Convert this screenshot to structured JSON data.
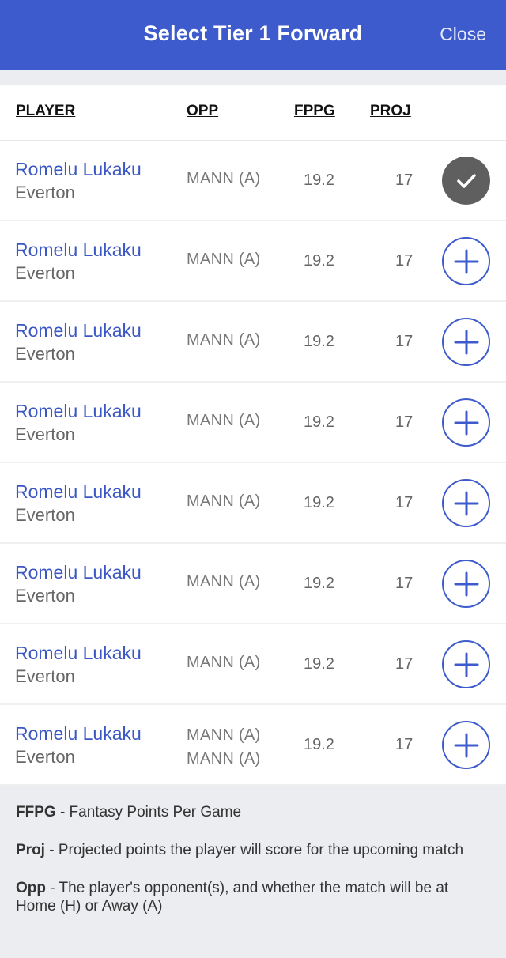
{
  "header": {
    "title": "Select Tier 1 Forward",
    "close_label": "Close"
  },
  "columns": {
    "player": "PLAYER",
    "opp": "OPP",
    "fppg": "FPPG",
    "proj": "PROJ"
  },
  "rows": [
    {
      "name": "Romelu Lukaku",
      "team": "Everton",
      "opp": [
        "MANN (A)"
      ],
      "fppg": "19.2",
      "proj": "17",
      "selected": true
    },
    {
      "name": "Romelu Lukaku",
      "team": "Everton",
      "opp": [
        "MANN (A)"
      ],
      "fppg": "19.2",
      "proj": "17",
      "selected": false
    },
    {
      "name": "Romelu Lukaku",
      "team": "Everton",
      "opp": [
        "MANN (A)"
      ],
      "fppg": "19.2",
      "proj": "17",
      "selected": false
    },
    {
      "name": "Romelu Lukaku",
      "team": "Everton",
      "opp": [
        "MANN (A)"
      ],
      "fppg": "19.2",
      "proj": "17",
      "selected": false
    },
    {
      "name": "Romelu Lukaku",
      "team": "Everton",
      "opp": [
        "MANN (A)"
      ],
      "fppg": "19.2",
      "proj": "17",
      "selected": false
    },
    {
      "name": "Romelu Lukaku",
      "team": "Everton",
      "opp": [
        "MANN (A)"
      ],
      "fppg": "19.2",
      "proj": "17",
      "selected": false
    },
    {
      "name": "Romelu Lukaku",
      "team": "Everton",
      "opp": [
        "MANN (A)"
      ],
      "fppg": "19.2",
      "proj": "17",
      "selected": false
    },
    {
      "name": "Romelu Lukaku",
      "team": "Everton",
      "opp": [
        "MANN (A)",
        "MANN (A)"
      ],
      "fppg": "19.2",
      "proj": "17",
      "selected": false
    }
  ],
  "icons": {
    "selected": "checkmark-icon",
    "add": "plus-icon"
  },
  "colors": {
    "accent": "#3d5bcc",
    "selected_bg": "#5f5f5f"
  },
  "legend": [
    {
      "term": "FFPG",
      "text": " - Fantasy Points Per Game"
    },
    {
      "term": "Proj",
      "text": " - Projected points the player will score for the upcoming match"
    },
    {
      "term": "Opp",
      "text": " - The player's opponent(s), and whether the match will be at Home (H) or Away (A)"
    }
  ]
}
